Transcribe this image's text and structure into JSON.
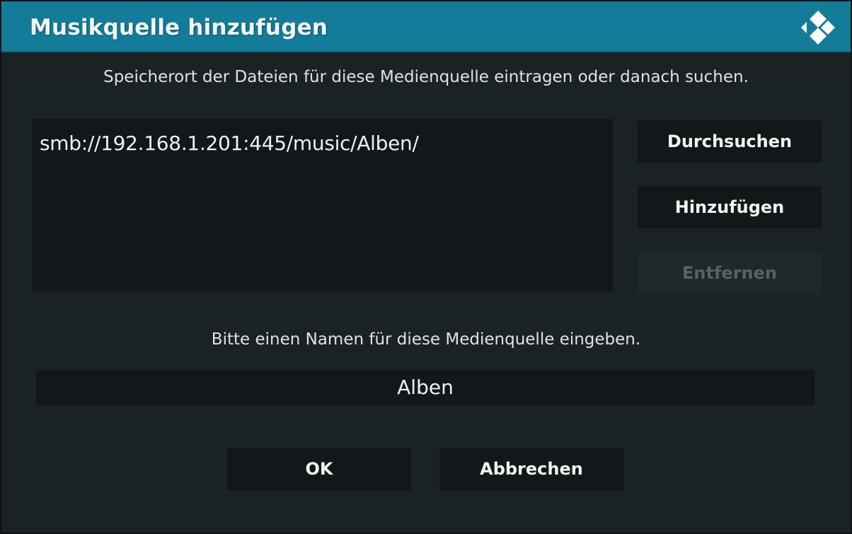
{
  "dialog": {
    "title": "Musikquelle hinzufügen",
    "logo_icon": "kodi-logo-icon"
  },
  "location": {
    "prompt": "Speicherort der Dateien für diese Medienquelle eintragen oder danach suchen.",
    "paths": [
      "smb://192.168.1.201:445/music/Alben/"
    ]
  },
  "side_buttons": {
    "browse_label": "Durchsuchen",
    "add_label": "Hinzufügen",
    "remove_label": "Entfernen"
  },
  "name": {
    "prompt": "Bitte einen Namen für diese Medienquelle eingeben.",
    "value": "Alben"
  },
  "footer": {
    "ok_label": "OK",
    "cancel_label": "Abbrechen"
  },
  "colors": {
    "titlebar": "#137d99",
    "background": "#1b2224",
    "panel": "#121719",
    "text": "#eef1f2",
    "disabled_text": "#5a6163"
  }
}
